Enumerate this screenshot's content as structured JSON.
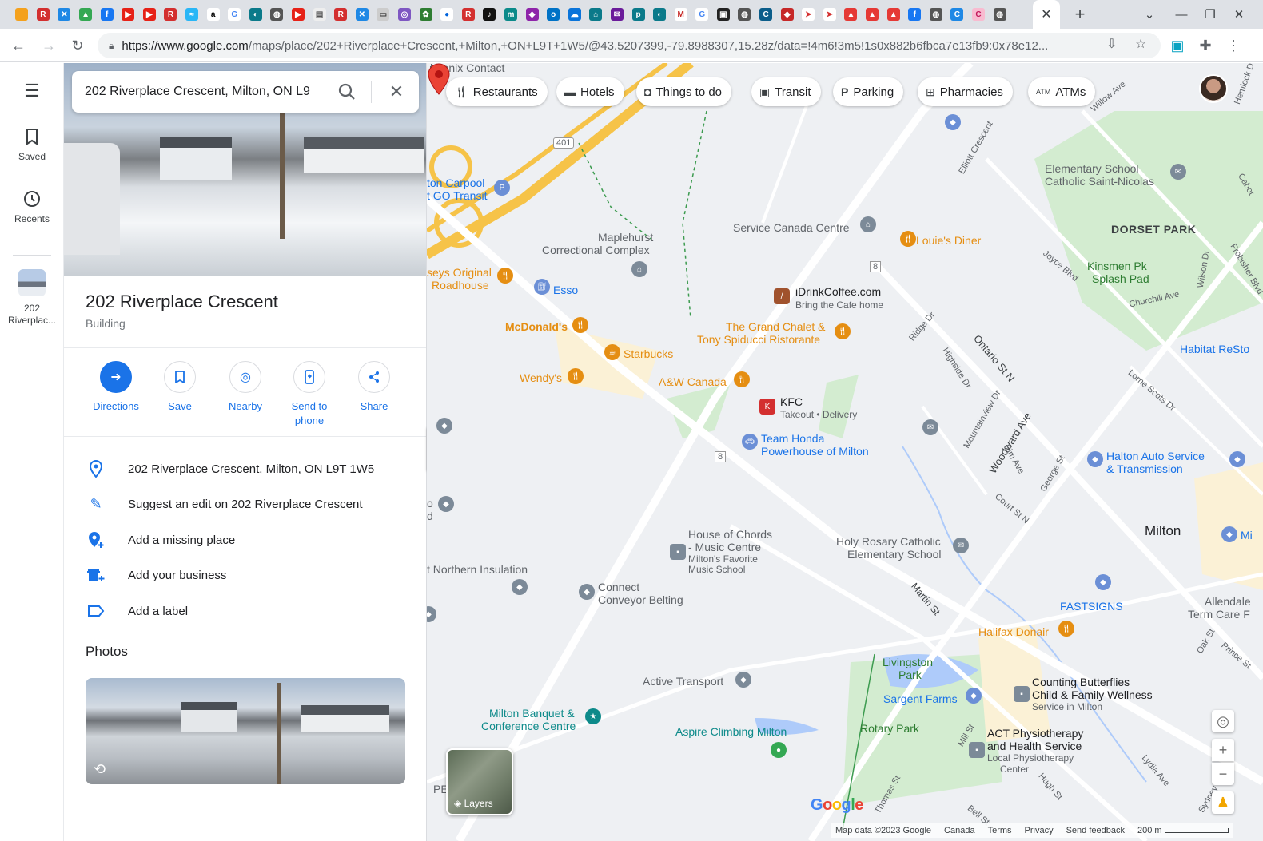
{
  "browser": {
    "active_tab_close": "✕",
    "new_tab": "+",
    "url_domain": "https://www.google.com",
    "url_rest": "/maps/place/202+Riverplace+Crescent,+Milton,+ON+L9T+1W5/@43.5207399,-79.8988307,15.28z/data=!4m6!3m5!1s0x882b6fbca7e13fb9:0x78e12..."
  },
  "rail": {
    "saved_label": "Saved",
    "recents_label": "Recents",
    "recent_place_label_1": "202",
    "recent_place_label_2": "Riverplac..."
  },
  "search": {
    "value": "202 Riverplace Crescent, Milton, ON L9"
  },
  "place": {
    "title": "202 Riverplace Crescent",
    "category": "Building",
    "actions": [
      {
        "label": "Directions"
      },
      {
        "label": "Save"
      },
      {
        "label": "Nearby"
      },
      {
        "label": "Send to phone"
      },
      {
        "label": "Share"
      }
    ],
    "info": [
      {
        "text": "202 Riverplace Crescent, Milton, ON L9T 1W5"
      },
      {
        "text": "Suggest an edit on 202 Riverplace Crescent"
      },
      {
        "text": "Add a missing place"
      },
      {
        "text": "Add your business"
      },
      {
        "text": "Add a label"
      }
    ],
    "photos_heading": "Photos"
  },
  "map": {
    "chips": [
      {
        "label": "Restaurants"
      },
      {
        "label": "Hotels"
      },
      {
        "label": "Things to do"
      },
      {
        "label": "Transit"
      },
      {
        "label": "Parking"
      },
      {
        "label": "Pharmacies"
      },
      {
        "label": "ATMs"
      }
    ],
    "labels": {
      "phoenix": "hoenix Contact",
      "carpool1": "ton Carpool",
      "carpool2": "t GO Transit",
      "maplehurst1": "Maplehurst",
      "maplehurst2": "Correctional Complex",
      "service_canada": "Service Canada Centre",
      "louies": "Louie's Diner",
      "elementary1": "Elementary School",
      "elementary2": "Catholic Saint-Nicolas",
      "dorset": "DORSET PARK",
      "kinsmen1": "Kinsmen Pk",
      "kinsmen2": "Splash Pad",
      "habitat": "Habitat ReSto",
      "seys1": "seys Original",
      "seys2": "Roadhouse",
      "esso": "Esso",
      "idrink": "iDrinkCoffee.com",
      "idrink_sub": "Bring the Cafe home",
      "mcdonalds": "McDonald's",
      "grand_chalet": "The Grand Chalet &",
      "tony": "Tony Spiducci Ristorante",
      "starbucks": "Starbucks",
      "wendys": "Wendy's",
      "aw": "A&W Canada",
      "kfc": "KFC",
      "kfc_sub": "Takeout • Delivery",
      "honda1": "Team Honda",
      "honda2": "Powerhouse of Milton",
      "halton1": "Halton Auto Service",
      "halton2": "& Transmission",
      "milton": "Milton",
      "mi": "Mi",
      "holy1": "Holy Rosary Catholic",
      "holy2": "Elementary School",
      "chords1": "House of Chords",
      "chords2": "- Music Centre",
      "chords_sub1": "Milton's Favorite",
      "chords_sub2": "Music School",
      "northern": "t Northern Insulation",
      "connect1": "Connect",
      "connect2": "Conveyor Belting",
      "fastsigns": "FASTSIGNS",
      "allendale1": "Allendale",
      "allendale2": "Term Care F",
      "halifax": "Halifax Donair",
      "livingston1": "Livingston",
      "livingston2": "Park",
      "active_transport": "Active Transport",
      "counting1": "Counting Butterflies",
      "counting2": "Child & Family Wellness",
      "counting_sub": "Service in Milton",
      "sargent": "Sargent Farms",
      "milton_banquet1": "Milton Banquet &",
      "milton_banquet2": "Conference Centre",
      "aspire": "Aspire Climbing Milton",
      "rotary": "Rotary Park",
      "act1": "ACT Physiotherapy",
      "act2": "and Health Service",
      "act_sub1": "Local Physiotherapy",
      "act_sub2": "Center",
      "o_d1": "o",
      "o_d2": "d",
      "pe": "PE"
    },
    "roads": {
      "r401": "401",
      "r8a": "8",
      "r8b": "8",
      "ontario": "Ontario St N",
      "woodward": "Woodward Ave",
      "martin": "Martin St",
      "ridge": "Ridge Dr",
      "highside": "Highside Dr",
      "mountainview": "Mountainview Dr",
      "elm": "Elm Ave",
      "george": "George St",
      "court": "Court St N",
      "elliott": "Elliott Crescent",
      "willow": "Willow Ave",
      "joyce": "Joyce Blvd",
      "wilson": "Wilson Dr",
      "frobisher": "Frobisher Blvd",
      "churchill": "Churchill Ave",
      "lorne": "Lorne Scots Dr",
      "oak": "Oak St",
      "prince": "Prince St",
      "mill": "Mill St",
      "hugh": "Hugh St",
      "lydia": "Lydia Ave",
      "sydney": "Sydney St",
      "bell": "Bell St",
      "cabot": "Cabot",
      "hemlock": "Hemlock D",
      "thomas": "Thomas St"
    },
    "layers_label": "Layers",
    "google_logo": "Google",
    "footer": {
      "map_data": "Map data ©2023 Google",
      "canada": "Canada",
      "terms": "Terms",
      "privacy": "Privacy",
      "feedback": "Send feedback",
      "scale": "200 m"
    },
    "colors": {
      "accent": "#1a73e8",
      "highway": "#f6c348",
      "park": "#cde9c8",
      "pin": "#ea4335",
      "restaurant": "#e58e12"
    }
  }
}
